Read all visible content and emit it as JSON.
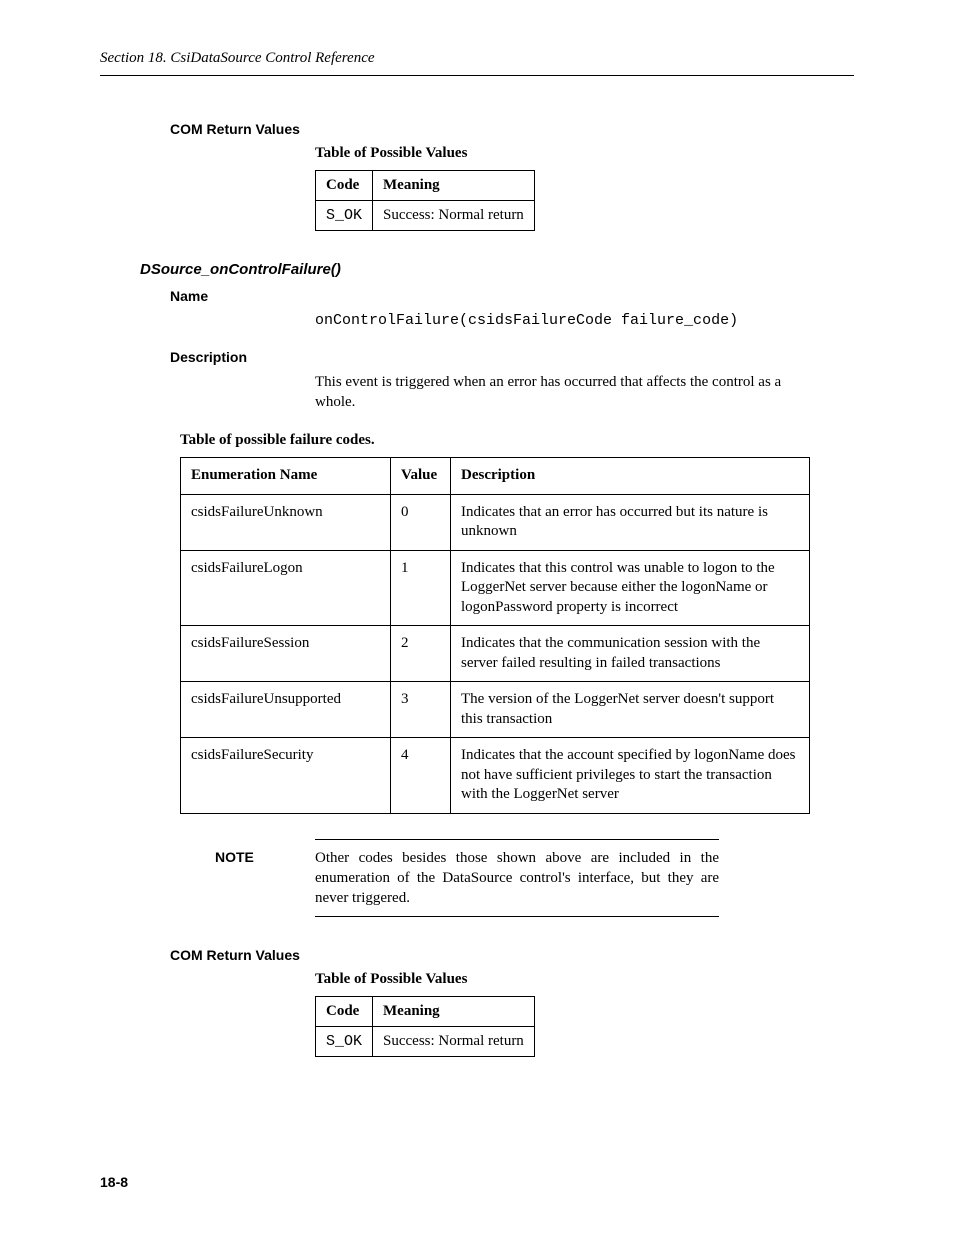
{
  "header": "Section 18.  CsiDataSource Control Reference",
  "section1": {
    "heading": "COM Return Values",
    "tableCaption": "Table of Possible Values",
    "tableHeaders": {
      "code": "Code",
      "meaning": "Meaning"
    },
    "rows": [
      {
        "code": "S_OK",
        "meaning": "Success: Normal return"
      }
    ]
  },
  "event": {
    "title": "DSource_onControlFailure()",
    "nameHeading": "Name",
    "nameCode": "onControlFailure(csidsFailureCode failure_code)",
    "descHeading": "Description",
    "descText": "This event is triggered when an error has occurred that affects the control as a whole.",
    "failureTableCaption": "Table of possible failure codes.",
    "failureHeaders": {
      "enum": "Enumeration Name",
      "value": "Value",
      "desc": "Description"
    },
    "failureRows": [
      {
        "enum": "csidsFailureUnknown",
        "value": "0",
        "desc": "Indicates that an error has occurred but its nature is unknown"
      },
      {
        "enum": "csidsFailureLogon",
        "value": "1",
        "desc": "Indicates that this control was unable to logon to the LoggerNet server because either the logonName or logonPassword property is incorrect"
      },
      {
        "enum": "csidsFailureSession",
        "value": "2",
        "desc": "Indicates that the communication session with the server failed resulting in failed transactions"
      },
      {
        "enum": "csidsFailureUnsupported",
        "value": "3",
        "desc": "The version of the LoggerNet server doesn't support this transaction"
      },
      {
        "enum": "csidsFailureSecurity",
        "value": "4",
        "desc": "Indicates that the account specified by logonName does not have sufficient privileges to start the transaction with the LoggerNet server"
      }
    ]
  },
  "note": {
    "label": "NOTE",
    "text": "Other codes besides those shown above are included in the enumeration of the DataSource control's interface, but they are never triggered."
  },
  "section2": {
    "heading": "COM Return Values",
    "tableCaption": "Table of Possible Values",
    "tableHeaders": {
      "code": "Code",
      "meaning": "Meaning"
    },
    "rows": [
      {
        "code": "S_OK",
        "meaning": "Success: Normal return"
      }
    ]
  },
  "pageNumber": "18-8"
}
